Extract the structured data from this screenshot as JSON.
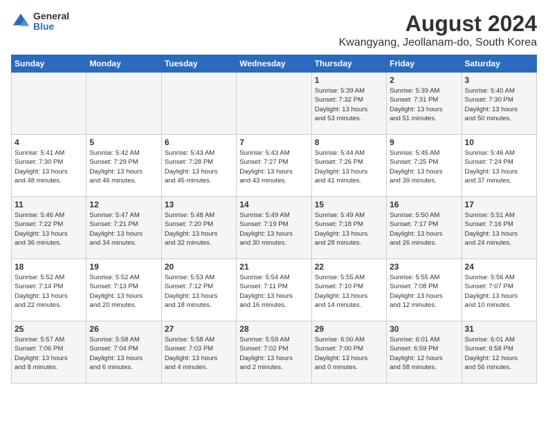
{
  "logo": {
    "general": "General",
    "blue": "Blue"
  },
  "title": "August 2024",
  "subtitle": "Kwangyang, Jeollanam-do, South Korea",
  "days": [
    "Sunday",
    "Monday",
    "Tuesday",
    "Wednesday",
    "Thursday",
    "Friday",
    "Saturday"
  ],
  "weeks": [
    [
      {
        "day": "",
        "content": ""
      },
      {
        "day": "",
        "content": ""
      },
      {
        "day": "",
        "content": ""
      },
      {
        "day": "",
        "content": ""
      },
      {
        "day": "1",
        "content": "Sunrise: 5:39 AM\nSunset: 7:32 PM\nDaylight: 13 hours\nand 53 minutes."
      },
      {
        "day": "2",
        "content": "Sunrise: 5:39 AM\nSunset: 7:31 PM\nDaylight: 13 hours\nand 51 minutes."
      },
      {
        "day": "3",
        "content": "Sunrise: 5:40 AM\nSunset: 7:30 PM\nDaylight: 13 hours\nand 50 minutes."
      }
    ],
    [
      {
        "day": "4",
        "content": "Sunrise: 5:41 AM\nSunset: 7:30 PM\nDaylight: 13 hours\nand 48 minutes."
      },
      {
        "day": "5",
        "content": "Sunrise: 5:42 AM\nSunset: 7:29 PM\nDaylight: 13 hours\nand 46 minutes."
      },
      {
        "day": "6",
        "content": "Sunrise: 5:43 AM\nSunset: 7:28 PM\nDaylight: 13 hours\nand 45 minutes."
      },
      {
        "day": "7",
        "content": "Sunrise: 5:43 AM\nSunset: 7:27 PM\nDaylight: 13 hours\nand 43 minutes."
      },
      {
        "day": "8",
        "content": "Sunrise: 5:44 AM\nSunset: 7:26 PM\nDaylight: 13 hours\nand 41 minutes."
      },
      {
        "day": "9",
        "content": "Sunrise: 5:45 AM\nSunset: 7:25 PM\nDaylight: 13 hours\nand 39 minutes."
      },
      {
        "day": "10",
        "content": "Sunrise: 5:46 AM\nSunset: 7:24 PM\nDaylight: 13 hours\nand 37 minutes."
      }
    ],
    [
      {
        "day": "11",
        "content": "Sunrise: 5:46 AM\nSunset: 7:22 PM\nDaylight: 13 hours\nand 36 minutes."
      },
      {
        "day": "12",
        "content": "Sunrise: 5:47 AM\nSunset: 7:21 PM\nDaylight: 13 hours\nand 34 minutes."
      },
      {
        "day": "13",
        "content": "Sunrise: 5:48 AM\nSunset: 7:20 PM\nDaylight: 13 hours\nand 32 minutes."
      },
      {
        "day": "14",
        "content": "Sunrise: 5:49 AM\nSunset: 7:19 PM\nDaylight: 13 hours\nand 30 minutes."
      },
      {
        "day": "15",
        "content": "Sunrise: 5:49 AM\nSunset: 7:18 PM\nDaylight: 13 hours\nand 28 minutes."
      },
      {
        "day": "16",
        "content": "Sunrise: 5:50 AM\nSunset: 7:17 PM\nDaylight: 13 hours\nand 26 minutes."
      },
      {
        "day": "17",
        "content": "Sunrise: 5:51 AM\nSunset: 7:16 PM\nDaylight: 13 hours\nand 24 minutes."
      }
    ],
    [
      {
        "day": "18",
        "content": "Sunrise: 5:52 AM\nSunset: 7:14 PM\nDaylight: 13 hours\nand 22 minutes."
      },
      {
        "day": "19",
        "content": "Sunrise: 5:52 AM\nSunset: 7:13 PM\nDaylight: 13 hours\nand 20 minutes."
      },
      {
        "day": "20",
        "content": "Sunrise: 5:53 AM\nSunset: 7:12 PM\nDaylight: 13 hours\nand 18 minutes."
      },
      {
        "day": "21",
        "content": "Sunrise: 5:54 AM\nSunset: 7:11 PM\nDaylight: 13 hours\nand 16 minutes."
      },
      {
        "day": "22",
        "content": "Sunrise: 5:55 AM\nSunset: 7:10 PM\nDaylight: 13 hours\nand 14 minutes."
      },
      {
        "day": "23",
        "content": "Sunrise: 5:55 AM\nSunset: 7:08 PM\nDaylight: 13 hours\nand 12 minutes."
      },
      {
        "day": "24",
        "content": "Sunrise: 5:56 AM\nSunset: 7:07 PM\nDaylight: 13 hours\nand 10 minutes."
      }
    ],
    [
      {
        "day": "25",
        "content": "Sunrise: 5:57 AM\nSunset: 7:06 PM\nDaylight: 13 hours\nand 8 minutes."
      },
      {
        "day": "26",
        "content": "Sunrise: 5:58 AM\nSunset: 7:04 PM\nDaylight: 13 hours\nand 6 minutes."
      },
      {
        "day": "27",
        "content": "Sunrise: 5:58 AM\nSunset: 7:03 PM\nDaylight: 13 hours\nand 4 minutes."
      },
      {
        "day": "28",
        "content": "Sunrise: 5:59 AM\nSunset: 7:02 PM\nDaylight: 13 hours\nand 2 minutes."
      },
      {
        "day": "29",
        "content": "Sunrise: 6:00 AM\nSunset: 7:00 PM\nDaylight: 13 hours\nand 0 minutes."
      },
      {
        "day": "30",
        "content": "Sunrise: 6:01 AM\nSunset: 6:59 PM\nDaylight: 12 hours\nand 58 minutes."
      },
      {
        "day": "31",
        "content": "Sunrise: 6:01 AM\nSunset: 6:58 PM\nDaylight: 12 hours\nand 56 minutes."
      }
    ]
  ]
}
